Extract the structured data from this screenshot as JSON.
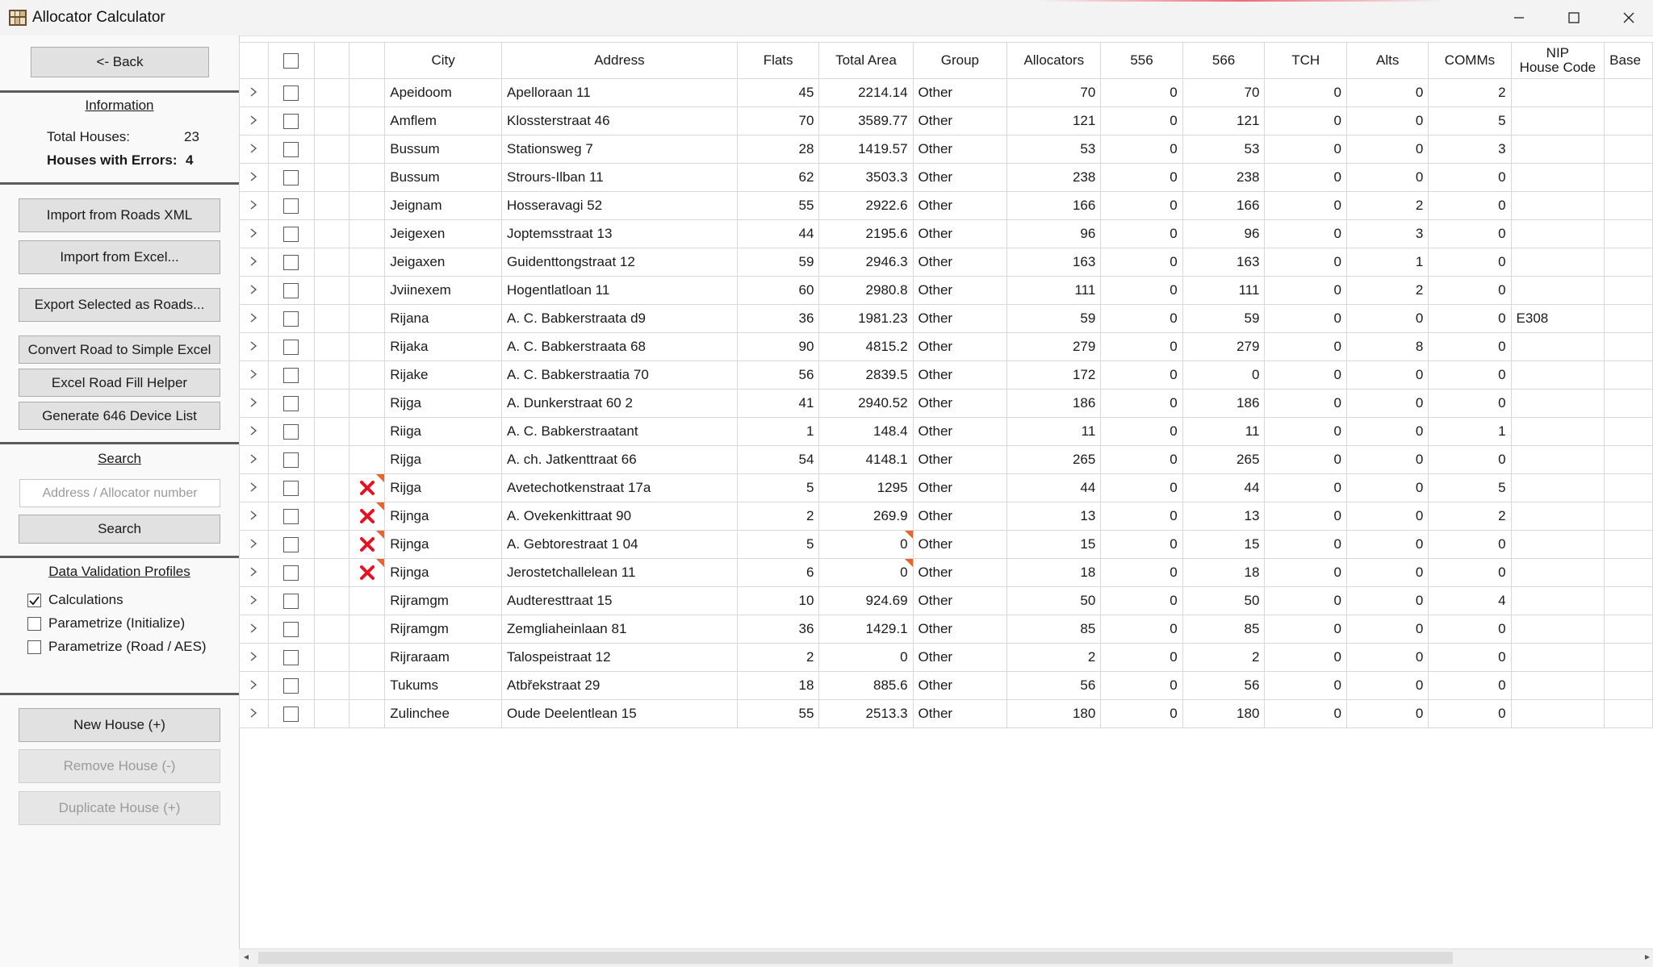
{
  "window": {
    "title": "Allocator Calculator",
    "controls": {
      "minimize": "—",
      "maximize": "☐",
      "close": "✕"
    },
    "accent_color": "#e81123"
  },
  "sidebar": {
    "back_label": "<- Back",
    "info_title": "Information",
    "total_houses_label": "Total Houses:",
    "total_houses_value": "23",
    "errors_label": "Houses with Errors:",
    "errors_value": "4",
    "buttons": {
      "import_roads_xml": "Import from Roads XML",
      "import_excel": "Import from Excel...",
      "export_selected": "Export Selected as Roads...",
      "convert_road": "Convert Road to Simple Excel",
      "excel_fill_helper": "Excel Road Fill Helper",
      "generate_646": "Generate 646 Device List"
    },
    "search": {
      "title": "Search",
      "placeholder": "Address / Allocator number",
      "button": "Search"
    },
    "validation": {
      "title": "Data Validation Profiles",
      "profiles": [
        {
          "label": "Calculations",
          "checked": true
        },
        {
          "label": "Parametrize (Initialize)",
          "checked": false
        },
        {
          "label": "Parametrize (Road / AES)",
          "checked": false
        }
      ]
    },
    "house_actions": {
      "new": "New House (+)",
      "remove": "Remove House (-)",
      "duplicate": "Duplicate House (+)"
    }
  },
  "table": {
    "columns": [
      "City",
      "Address",
      "Flats",
      "Total Area",
      "Group",
      "Allocators",
      "556",
      "566",
      "TCH",
      "Alts",
      "COMMs",
      "NIP\nHouse Code",
      "Base"
    ],
    "rows": [
      {
        "error": false,
        "city": "Apeidoom",
        "address": "Apelloraan 11",
        "flats": "45",
        "area": "2214.14",
        "area_flag": false,
        "group": "Other",
        "allocators": "70",
        "c556": "0",
        "c566": "70",
        "tch": "0",
        "alts": "0",
        "comms": "2",
        "nip": ""
      },
      {
        "error": false,
        "city": "Amflem",
        "address": "Klossterstraat 46",
        "flats": "70",
        "area": "3589.77",
        "area_flag": false,
        "group": "Other",
        "allocators": "121",
        "c556": "0",
        "c566": "121",
        "tch": "0",
        "alts": "0",
        "comms": "5",
        "nip": ""
      },
      {
        "error": false,
        "city": "Bussum",
        "address": "Stationsweg 7",
        "flats": "28",
        "area": "1419.57",
        "area_flag": false,
        "group": "Other",
        "allocators": "53",
        "c556": "0",
        "c566": "53",
        "tch": "0",
        "alts": "0",
        "comms": "3",
        "nip": ""
      },
      {
        "error": false,
        "city": "Bussum",
        "address": "Strours-Ilban 11",
        "flats": "62",
        "area": "3503.3",
        "area_flag": false,
        "group": "Other",
        "allocators": "238",
        "c556": "0",
        "c566": "238",
        "tch": "0",
        "alts": "0",
        "comms": "0",
        "nip": ""
      },
      {
        "error": false,
        "city": "Jeignam",
        "address": "Hosseravagi 52",
        "flats": "55",
        "area": "2922.6",
        "area_flag": false,
        "group": "Other",
        "allocators": "166",
        "c556": "0",
        "c566": "166",
        "tch": "0",
        "alts": "2",
        "comms": "0",
        "nip": ""
      },
      {
        "error": false,
        "city": "Jeigexen",
        "address": "Joptemsstraat 13",
        "flats": "44",
        "area": "2195.6",
        "area_flag": false,
        "group": "Other",
        "allocators": "96",
        "c556": "0",
        "c566": "96",
        "tch": "0",
        "alts": "3",
        "comms": "0",
        "nip": ""
      },
      {
        "error": false,
        "city": "Jeigaxen",
        "address": "Guidenttongstraat 12",
        "flats": "59",
        "area": "2946.3",
        "area_flag": false,
        "group": "Other",
        "allocators": "163",
        "c556": "0",
        "c566": "163",
        "tch": "0",
        "alts": "1",
        "comms": "0",
        "nip": ""
      },
      {
        "error": false,
        "city": "Jviinexem",
        "address": "Hogentlatloan 11",
        "flats": "60",
        "area": "2980.8",
        "area_flag": false,
        "group": "Other",
        "allocators": "111",
        "c556": "0",
        "c566": "111",
        "tch": "0",
        "alts": "2",
        "comms": "0",
        "nip": ""
      },
      {
        "error": false,
        "city": "Rijana",
        "address": "A. C. Babkerstraata d9",
        "flats": "36",
        "area": "1981.23",
        "area_flag": false,
        "group": "Other",
        "allocators": "59",
        "c556": "0",
        "c566": "59",
        "tch": "0",
        "alts": "0",
        "comms": "0",
        "nip": "E308"
      },
      {
        "error": false,
        "city": "Rijaka",
        "address": "A. C. Babkerstraata 68",
        "flats": "90",
        "area": "4815.2",
        "area_flag": false,
        "group": "Other",
        "allocators": "279",
        "c556": "0",
        "c566": "279",
        "tch": "0",
        "alts": "8",
        "comms": "0",
        "nip": ""
      },
      {
        "error": false,
        "city": "Rijake",
        "address": "A. C. Babkerstraatia 70",
        "flats": "56",
        "area": "2839.5",
        "area_flag": false,
        "group": "Other",
        "allocators": "172",
        "c556": "0",
        "c566": "0",
        "tch": "0",
        "alts": "0",
        "comms": "0",
        "nip": ""
      },
      {
        "error": false,
        "city": "Rijga",
        "address": "A. Dunkerstraat 60  2",
        "flats": "41",
        "area": "2940.52",
        "area_flag": false,
        "group": "Other",
        "allocators": "186",
        "c556": "0",
        "c566": "186",
        "tch": "0",
        "alts": "0",
        "comms": "0",
        "nip": ""
      },
      {
        "error": false,
        "city": "Riiga",
        "address": "A. C. Babkerstraatant",
        "flats": "1",
        "area": "148.4",
        "area_flag": false,
        "group": "Other",
        "allocators": "11",
        "c556": "0",
        "c566": "11",
        "tch": "0",
        "alts": "0",
        "comms": "1",
        "nip": ""
      },
      {
        "error": false,
        "city": "Rijga",
        "address": "A. ch. Jatkenttraat 66",
        "flats": "54",
        "area": "4148.1",
        "area_flag": false,
        "group": "Other",
        "allocators": "265",
        "c556": "0",
        "c566": "265",
        "tch": "0",
        "alts": "0",
        "comms": "0",
        "nip": ""
      },
      {
        "error": true,
        "city": "Rijga",
        "address": "Avetechotkenstraat 17a",
        "flats": "5",
        "area": "1295",
        "area_flag": false,
        "group": "Other",
        "allocators": "44",
        "c556": "0",
        "c566": "44",
        "tch": "0",
        "alts": "0",
        "comms": "5",
        "nip": ""
      },
      {
        "error": true,
        "city": "Rijnga",
        "address": "A. Ovekenkittraat 90",
        "flats": "2",
        "area": "269.9",
        "area_flag": false,
        "group": "Other",
        "allocators": "13",
        "c556": "0",
        "c566": "13",
        "tch": "0",
        "alts": "0",
        "comms": "2",
        "nip": ""
      },
      {
        "error": true,
        "city": "Rijnga",
        "address": "A. Gebtorestraat 1 04",
        "flats": "5",
        "area": "0",
        "area_flag": true,
        "group": "Other",
        "allocators": "15",
        "c556": "0",
        "c566": "15",
        "tch": "0",
        "alts": "0",
        "comms": "0",
        "nip": ""
      },
      {
        "error": true,
        "city": "Rijnga",
        "address": "Jerostetchallelean 11",
        "flats": "6",
        "area": "0",
        "area_flag": true,
        "group": "Other",
        "allocators": "18",
        "c556": "0",
        "c566": "18",
        "tch": "0",
        "alts": "0",
        "comms": "0",
        "nip": ""
      },
      {
        "error": false,
        "city": "Rijramgm",
        "address": "Audteresttraat 15",
        "flats": "10",
        "area": "924.69",
        "area_flag": false,
        "group": "Other",
        "allocators": "50",
        "c556": "0",
        "c566": "50",
        "tch": "0",
        "alts": "0",
        "comms": "4",
        "nip": ""
      },
      {
        "error": false,
        "city": "Rijramgm",
        "address": "Zemgliaheinlaan 81",
        "flats": "36",
        "area": "1429.1",
        "area_flag": false,
        "group": "Other",
        "allocators": "85",
        "c556": "0",
        "c566": "85",
        "tch": "0",
        "alts": "0",
        "comms": "0",
        "nip": ""
      },
      {
        "error": false,
        "city": "Rijraraam",
        "address": "Talospeistraat 12",
        "flats": "2",
        "area": "0",
        "area_flag": false,
        "group": "Other",
        "allocators": "2",
        "c556": "0",
        "c566": "2",
        "tch": "0",
        "alts": "0",
        "comms": "0",
        "nip": ""
      },
      {
        "error": false,
        "city": "Tukums",
        "address": "Atbřekstraat 29",
        "flats": "18",
        "area": "885.6",
        "area_flag": false,
        "group": "Other",
        "allocators": "56",
        "c556": "0",
        "c566": "56",
        "tch": "0",
        "alts": "0",
        "comms": "0",
        "nip": ""
      },
      {
        "error": false,
        "city": "Zulinchee",
        "address": "Oude Deelentlean 15",
        "flats": "55",
        "area": "2513.3",
        "area_flag": false,
        "group": "Other",
        "allocators": "180",
        "c556": "0",
        "c566": "180",
        "tch": "0",
        "alts": "0",
        "comms": "0",
        "nip": ""
      }
    ]
  },
  "colors": {
    "error_x": "#e81123",
    "flag_triangle": "#e8642c",
    "separator": "#5c5c5c"
  },
  "icons": {
    "app": "calculator-app-icon",
    "expand": "chevron-right-icon",
    "error": "error-x-icon",
    "check": "checkmark-icon"
  }
}
